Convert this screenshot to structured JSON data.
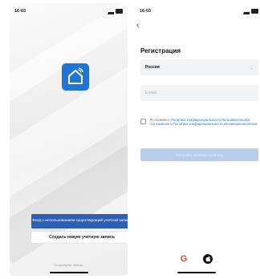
{
  "left": {
    "status_time": "16:03",
    "login_button": "Вход с использованием существующей учетной записи",
    "create_button": "Создать новую учетную запись",
    "trial_text": "Попробуйте сейчас"
  },
  "right": {
    "status_time": "16:03",
    "back_icon": "chevron-left-icon",
    "title": "Регистрация",
    "country_value": "Россия",
    "email_placeholder": "E-mail",
    "agree_prefix": "Я согласен с",
    "agree_link1": "Политика конфиденциальности",
    "agree_mid": " Пользовательское Соглашение и ",
    "agree_link2": "Политика конфиденциальности несовершеннолетних",
    "code_button": "Получить проверочный код"
  },
  "colors": {
    "accent": "#1f74d6",
    "login_button": "#2f5fb3",
    "disabled_button": "#b8ccec"
  },
  "icons": [
    "home-wifi-icon",
    "google-icon",
    "apple-icon",
    "signal-icon",
    "battery-icon"
  ]
}
